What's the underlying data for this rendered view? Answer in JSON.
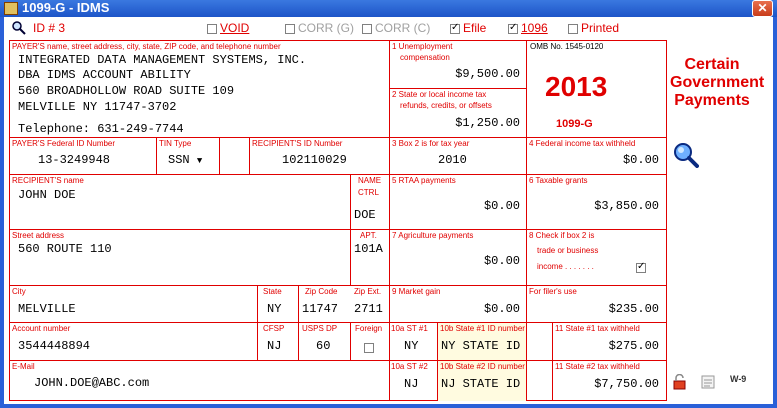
{
  "window": {
    "title": "1099-G - IDMS",
    "close_glyph": "✕"
  },
  "header": {
    "id_label": "ID # 3",
    "void": "VOID",
    "corr_g": "CORR (G)",
    "corr_c": "CORR (C)",
    "efile": "Efile",
    "f1096": "1096",
    "printed": "Printed"
  },
  "payer": {
    "label": "PAYER'S name, street address, city, state, ZIP code, and telephone number",
    "line1": "INTEGRATED DATA MANAGEMENT SYSTEMS, INC.",
    "line2": "DBA IDMS ACCOUNT ABILITY",
    "line3": "560 BROADHOLLOW ROAD SUITE 109",
    "line4": "MELVILLE NY 11747-3702",
    "telephone": "Telephone: 631-249-7744"
  },
  "box1": {
    "label1": "1 Unemployment",
    "label2": "compensation",
    "value": "$9,500.00"
  },
  "box2": {
    "label1": "2 State or local income tax",
    "label2": "refunds, credits, or offsets",
    "value": "$1,250.00"
  },
  "omb": {
    "label": "OMB No. 1545-0120",
    "year": "2013",
    "form": "1099-G"
  },
  "heading": {
    "l1": "Certain",
    "l2": "Government",
    "l3": "Payments"
  },
  "payer_id": {
    "label": "PAYER'S Federal ID Number",
    "value": "13-3249948"
  },
  "tin": {
    "label": "TIN Type",
    "value": "SSN"
  },
  "recip_id": {
    "label": "RECIPIENT'S ID Number",
    "value": "102110029"
  },
  "box3": {
    "label": "3 Box 2 is for tax year",
    "value": "2010"
  },
  "box4": {
    "label": "4 Federal income tax withheld",
    "value": "$0.00"
  },
  "recipient": {
    "label": "RECIPIENT'S name",
    "value": "JOHN DOE"
  },
  "name_ctrl": {
    "label1": "NAME",
    "label2": "CTRL",
    "value": "DOE"
  },
  "box5": {
    "label": "5 RTAA payments",
    "value": "$0.00"
  },
  "box6": {
    "label": "6 Taxable grants",
    "value": "$3,850.00"
  },
  "street": {
    "label": "Street address",
    "value": "560 ROUTE 110"
  },
  "apt": {
    "label": "APT.",
    "value": "101A"
  },
  "box7": {
    "label": "7 Agriculture payments",
    "value": "$0.00"
  },
  "box8": {
    "label1": "8 Check if box 2 is",
    "label2": "trade or business",
    "label3": "income . . . . . . ."
  },
  "city": {
    "label": "City",
    "value": "MELVILLE"
  },
  "state": {
    "label": "State",
    "value": "NY"
  },
  "zip": {
    "label": "Zip Code",
    "value": "11747"
  },
  "zipext": {
    "label": "Zip Ext.",
    "value": "2711"
  },
  "box9": {
    "label": "9 Market gain",
    "value": "$0.00"
  },
  "filer": {
    "label": "For filer's use",
    "value": "$235.00"
  },
  "account": {
    "label": "Account number",
    "value": "3544448894"
  },
  "cfsp": {
    "label": "CFSP",
    "value": "NJ"
  },
  "uspsdp": {
    "label": "USPS DP",
    "value": "60"
  },
  "foreign": {
    "label": "Foreign"
  },
  "st1": {
    "label": "10a ST #1",
    "value": "NY"
  },
  "st1id": {
    "label": "10b State #1 ID number",
    "value": "NY STATE ID"
  },
  "st1tax": {
    "label": "11 State #1 tax withheld",
    "value": "$275.00"
  },
  "email": {
    "label": "E-Mail",
    "value": "JOHN.DOE@ABC.com"
  },
  "st2": {
    "label": "10a ST #2",
    "value": "NJ"
  },
  "st2id": {
    "label": "10b State #2 ID number",
    "value": "NJ STATE ID"
  },
  "st2tax": {
    "label": "11 State #2 tax withheld",
    "value": "$7,750.00"
  },
  "side": {
    "w9": "W-9"
  }
}
